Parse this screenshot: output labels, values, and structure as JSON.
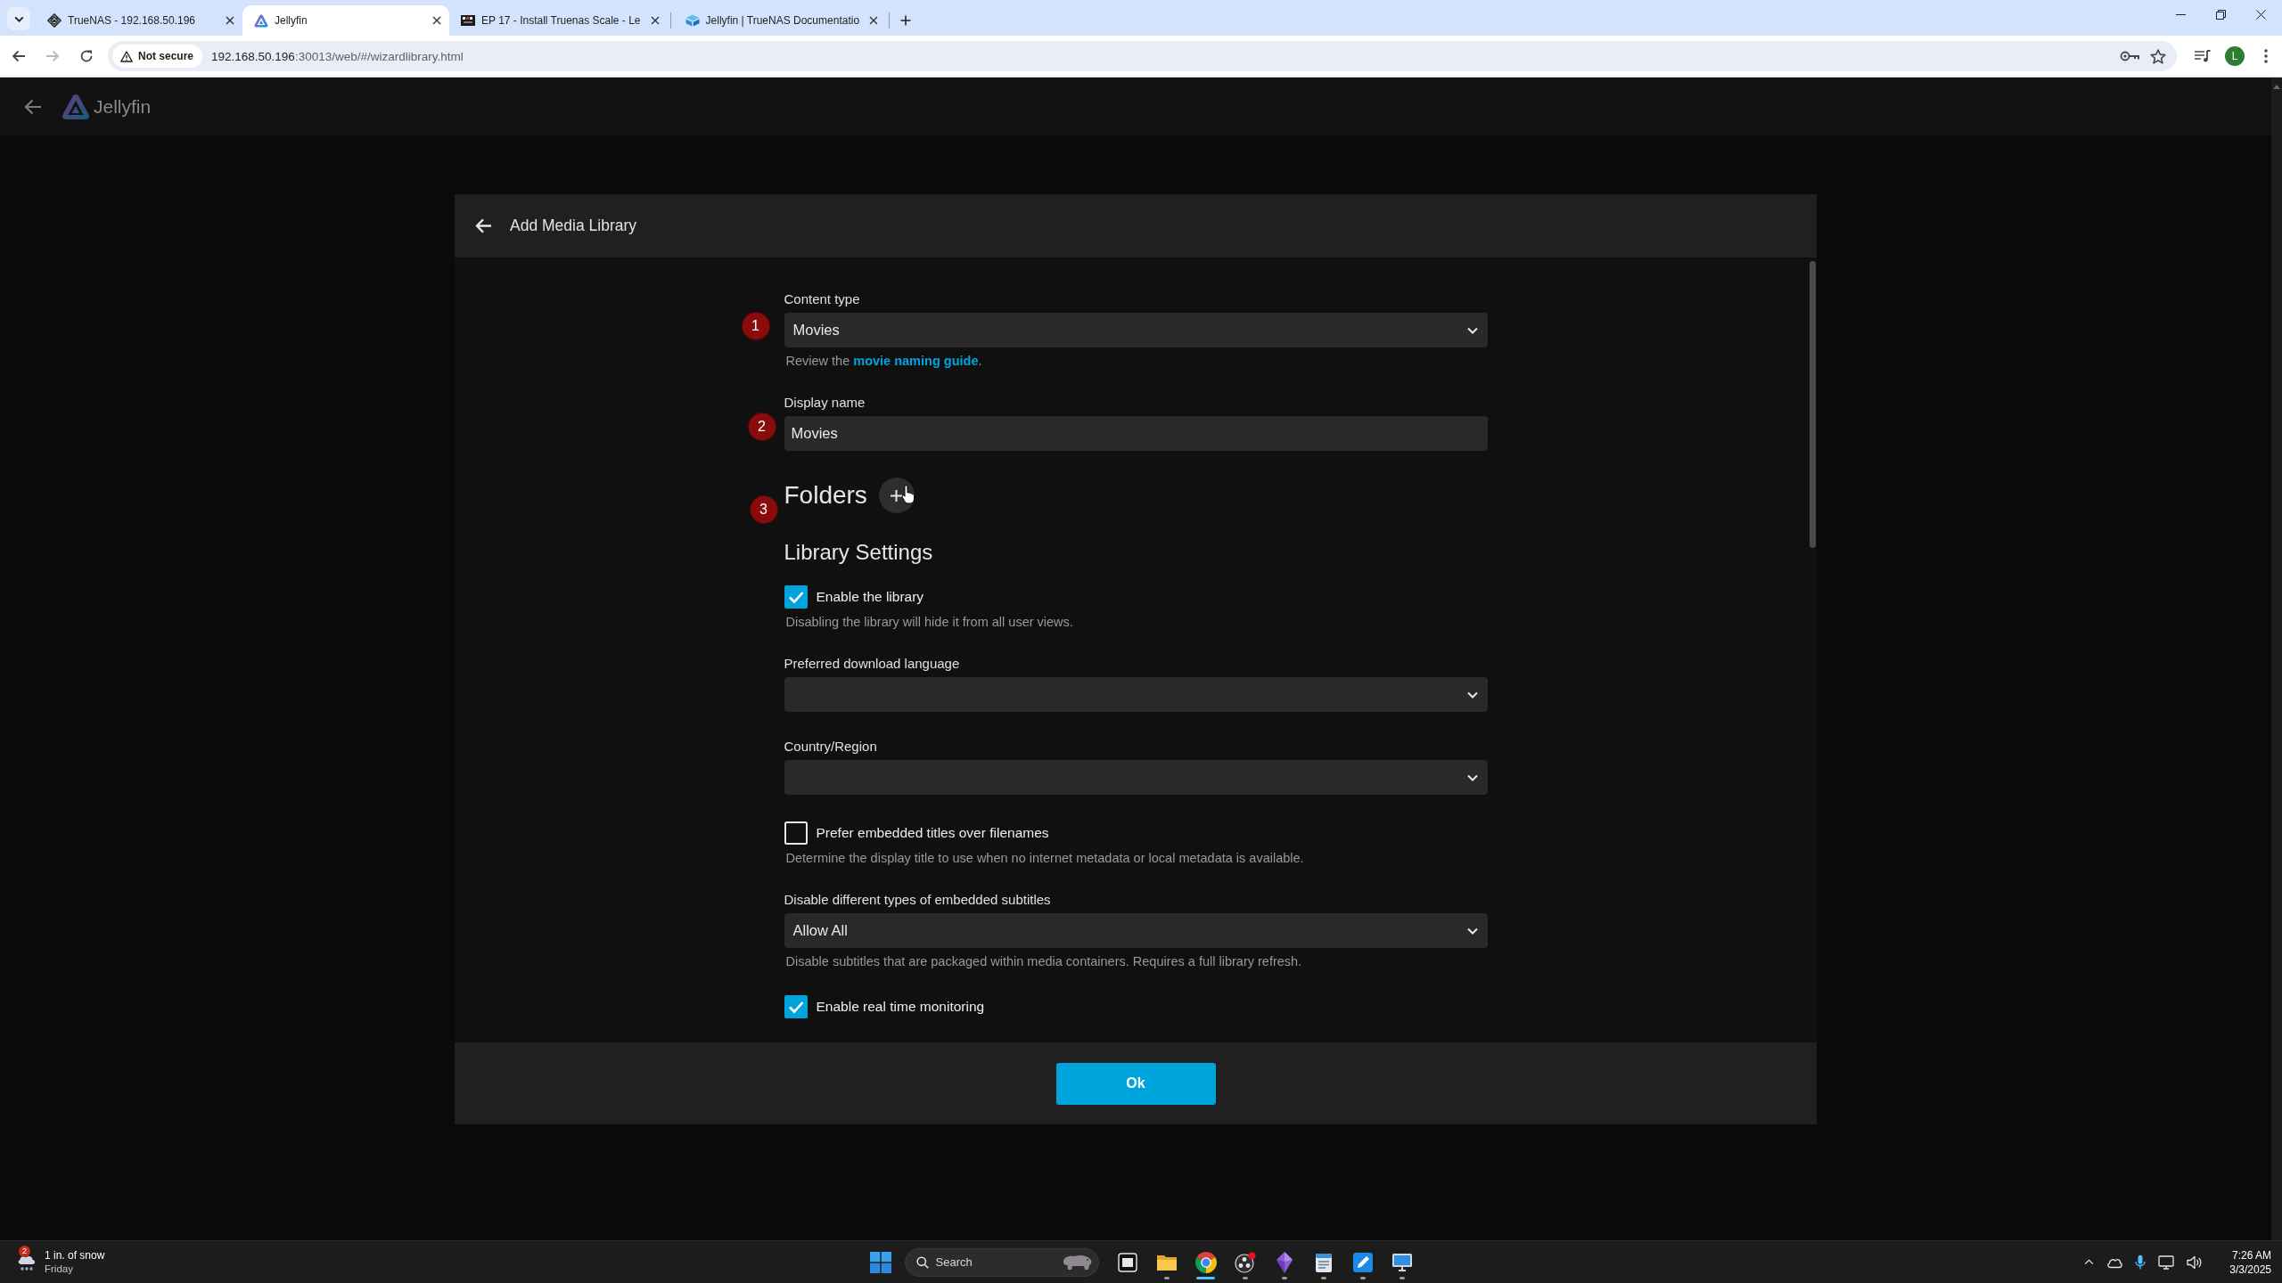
{
  "browser": {
    "tabs": [
      {
        "kind": "knot",
        "title": "TrueNAS - 192.168.50.196",
        "selected": false
      },
      {
        "kind": "triangle",
        "title": "Jellyfin",
        "selected": true
      },
      {
        "kind": "thumbnail",
        "title": "EP 17 - Install Truenas Scale - Le",
        "selected": false
      },
      {
        "kind": "cube",
        "title": "Jellyfin | TrueNAS Documentatio",
        "selected": false
      }
    ],
    "forward_disabled": true,
    "security": "Not secure",
    "url_host": "192.168.50.196",
    "url_path": ":30013/web/#/wizardlibrary.html",
    "profile_initial": "L"
  },
  "app_header": {
    "brand": "Jellyfin"
  },
  "dialog": {
    "title": "Add Media Library",
    "fields": [
      {
        "kind": "select",
        "step": "1",
        "label": "Content type",
        "value": "Movies",
        "help": "Review the ",
        "help_link": "movie naming guide",
        "help_end": "."
      },
      {
        "kind": "input",
        "step": "2",
        "label": "Display name",
        "value": "Movies"
      },
      {
        "kind": "folders",
        "step": "3",
        "label": "Folders"
      },
      {
        "kind": "heading",
        "label": "Library Settings"
      },
      {
        "kind": "checkbox",
        "label": "Enable the library",
        "checked": true,
        "help": "Disabling the library will hide it from all user views."
      },
      {
        "kind": "select",
        "label": "Preferred download language"
      },
      {
        "kind": "select",
        "label": "Country/Region"
      },
      {
        "kind": "checkbox",
        "label": "Prefer embedded titles over filenames",
        "checked": false,
        "help": "Determine the display title to use when no internet metadata or local metadata is available."
      },
      {
        "kind": "select",
        "label": "Disable different types of embedded subtitles",
        "value": "Allow All",
        "help": "Disable subtitles that are packaged within media containers. Requires a full library refresh."
      },
      {
        "kind": "checkbox",
        "label": "Enable real time monitoring",
        "checked": true
      }
    ],
    "ok_button": "Ok"
  },
  "taskbar": {
    "weather": {
      "badge": "2",
      "condition": "1 in. of snow",
      "day": "Friday"
    },
    "search_placeholder": "Search",
    "apps": [
      {
        "kind": "taskview",
        "running": false,
        "selected": false
      },
      {
        "kind": "folder",
        "running": true,
        "selected": false
      },
      {
        "kind": "browser",
        "running": true,
        "selected": true
      },
      {
        "kind": "recorder",
        "running": true,
        "selected": false
      },
      {
        "kind": "gem",
        "running": true,
        "selected": false
      },
      {
        "kind": "notepad",
        "running": true,
        "selected": false
      },
      {
        "kind": "pen",
        "running": true,
        "selected": false
      },
      {
        "kind": "monitor",
        "running": true,
        "selected": false
      }
    ],
    "clock_time": "7:26 AM",
    "clock_date": "3/3/2025"
  }
}
